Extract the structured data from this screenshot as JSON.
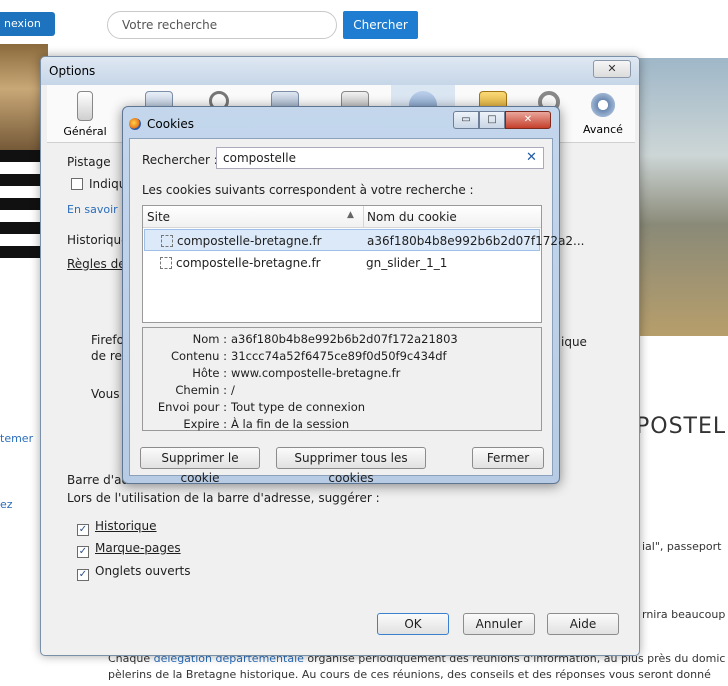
{
  "background": {
    "connexion_label": "nexion",
    "search_placeholder": "Votre recherche",
    "search_button": "Chercher",
    "title_fragment": "POSTEL",
    "link_fragment_1": "temer",
    "link_fragment_2": "ez",
    "text_fragment_1": "ial\", passeport",
    "text_fragment_2": "rnira beaucoup",
    "bottom_line_1_prefix": "Chaque ",
    "bottom_line_1_link": "délégation départementale",
    "bottom_line_1_rest": " organise périodiquement des réunions d'information, au plus près du domic",
    "bottom_line_2": "pèlerins de la Bretagne historique. Au cours de ces réunions, des conseils et des réponses vous seront donné"
  },
  "options": {
    "title": "Options",
    "close_label": "✕",
    "toolbar": [
      {
        "label": "Général",
        "icon": "switch-icon"
      },
      {
        "label": "",
        "icon": "tabs-icon"
      },
      {
        "label": "",
        "icon": "search-icon"
      },
      {
        "label": "",
        "icon": "content-icon"
      },
      {
        "label": "",
        "icon": "applications-icon"
      },
      {
        "label": "",
        "icon": "privacy-mask-icon"
      },
      {
        "label": "",
        "icon": "lock-icon"
      },
      {
        "label": "",
        "icon": "sync-icon"
      },
      {
        "label": "Avancé",
        "icon": "gear-icon"
      }
    ],
    "pistage_heading": "Pistage",
    "pistage_check_label": "Indiqu",
    "pistage_link": "En savoir p",
    "historique_heading": "Historique",
    "historique_rules": "Règles de c",
    "firefox_text_1": "Firefox",
    "firefox_text_2": "de rec",
    "firefox_text_3": "ique",
    "vous_text": "Vous v",
    "address_bar_heading": "Barre d'adr",
    "address_bar_desc": "Lors de l'utilisation de la barre d'adresse, suggérer :",
    "suggest_items": [
      {
        "label": "Historique",
        "checked": true
      },
      {
        "label": "Marque-pages",
        "checked": true
      },
      {
        "label": "Onglets ouverts",
        "checked": true
      }
    ],
    "ok_label": "OK",
    "cancel_label": "Annuler",
    "help_label": "Aide"
  },
  "cookies": {
    "title": "Cookies",
    "search_label": "Rechercher :",
    "search_value": "compostelle",
    "clear_label": "✕",
    "note": "Les cookies suivants correspondent à votre recherche :",
    "col_site": "Site",
    "col_name": "Nom du cookie",
    "rows": [
      {
        "site": "compostelle-bretagne.fr",
        "name": "a36f180b4b8e992b6b2d07f172a2..."
      },
      {
        "site": "compostelle-bretagne.fr",
        "name": "gn_slider_1_1"
      }
    ],
    "details": [
      {
        "label": "Nom :",
        "value": "a36f180b4b8e992b6b2d07f172a21803"
      },
      {
        "label": "Contenu :",
        "value": "31ccc74a52f6475ce89f0d50f9c434df"
      },
      {
        "label": "Hôte :",
        "value": "www.compostelle-bretagne.fr"
      },
      {
        "label": "Chemin :",
        "value": "/"
      },
      {
        "label": "Envoi pour :",
        "value": "Tout type de connexion"
      },
      {
        "label": "Expire :",
        "value": "À la fin de la session"
      }
    ],
    "delete_one": "Supprimer le cookie",
    "delete_all": "Supprimer tous les cookies",
    "close_button": "Fermer"
  }
}
